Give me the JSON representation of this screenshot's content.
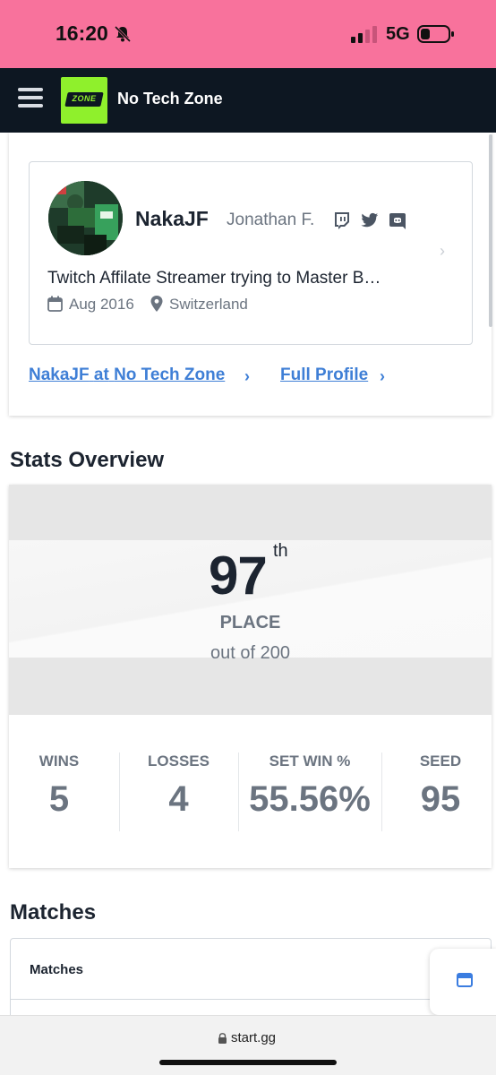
{
  "status_bar": {
    "time": "16:20",
    "network": "5G"
  },
  "header": {
    "title": "No Tech Zone",
    "logo_text": "ZONE"
  },
  "profile": {
    "gamer_tag": "NakaJF",
    "real_name": "Jonathan F.",
    "bio": "Twitch Affilate Streamer trying to Master B…",
    "joined": "Aug 2016",
    "location": "Switzerland",
    "socials": [
      "twitch-icon",
      "twitter-icon",
      "discord-icon"
    ]
  },
  "links": {
    "tournament_link_prefix": "NakaJF",
    "tournament_link_at": "at",
    "tournament_link_name": "No Tech Zone",
    "full_profile": "Full Profile"
  },
  "stats": {
    "heading": "Stats Overview",
    "placement": "97",
    "placement_suffix": "th",
    "placement_label": "PLACE",
    "placement_total": "out of 200",
    "items": [
      {
        "label": "WINS",
        "value": "5"
      },
      {
        "label": "LOSSES",
        "value": "4"
      },
      {
        "label": "SET WIN %",
        "value": "55.56%"
      },
      {
        "label": "SEED",
        "value": "95"
      }
    ]
  },
  "matches": {
    "heading": "Matches",
    "tab": "Matches"
  },
  "browser": {
    "url": "start.gg"
  },
  "colors": {
    "status_bar": "#f8729c",
    "header_bg": "#0d1722",
    "logo_green": "#8ff02c",
    "link_blue": "#3f7fd6"
  }
}
